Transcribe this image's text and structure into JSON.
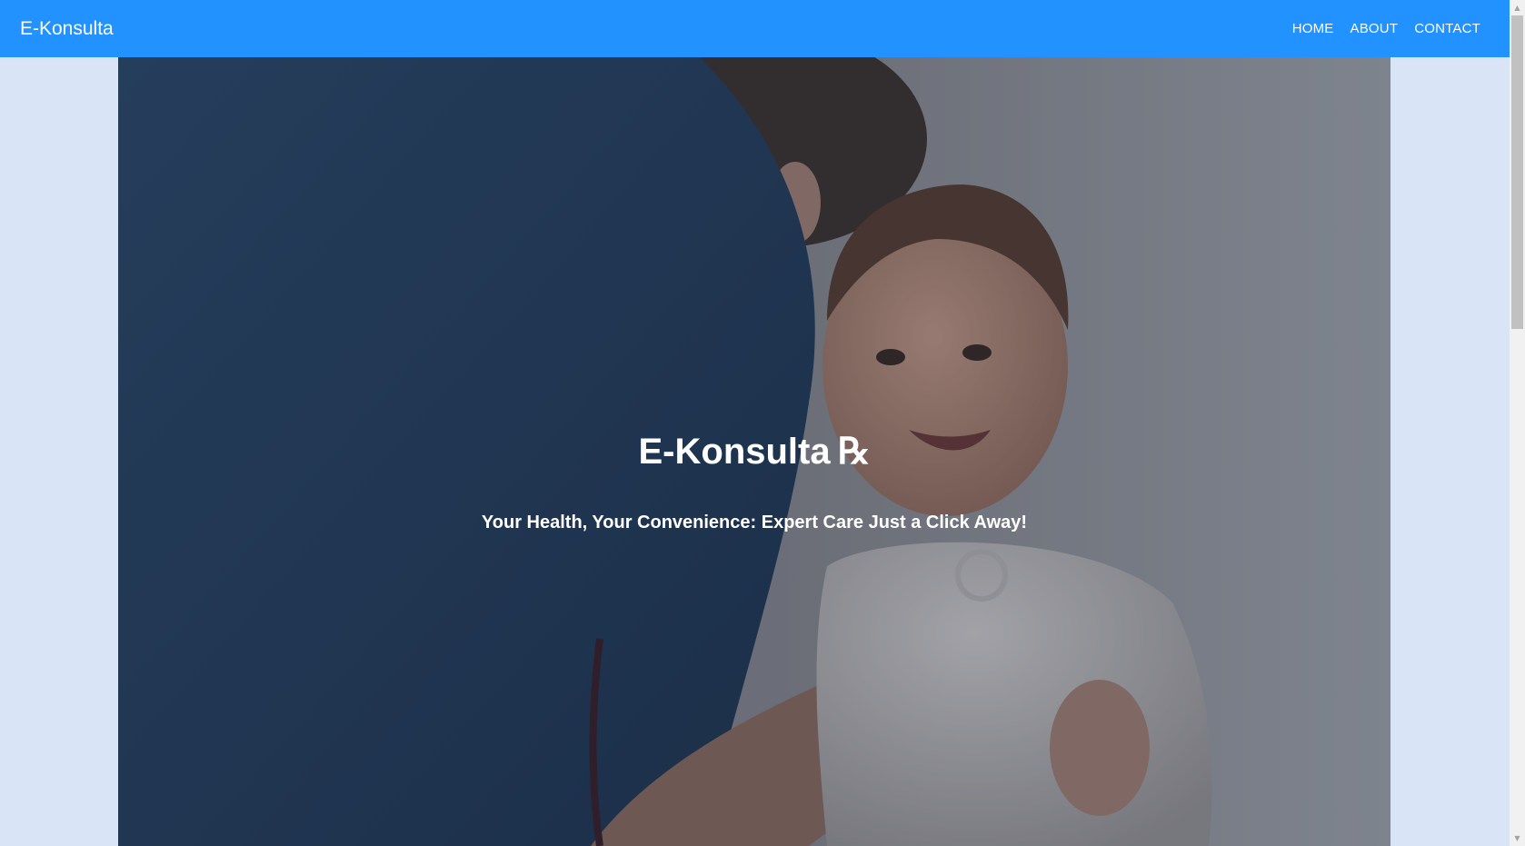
{
  "navbar": {
    "brand": "E-Konsulta",
    "links": [
      "HOME",
      "ABOUT",
      "CONTACT"
    ],
    "background_color": "#2192ff"
  },
  "hero": {
    "title": "E-Konsulta",
    "title_icon": "prescription-rx-icon",
    "title_icon_glyph": "℞",
    "subtitle": "Your Health, Your Convenience: Expert Care Just a Click Away!",
    "image_subject": "doctor examining a smiling baby with a stethoscope"
  },
  "colors": {
    "page_background": "#d9e5f7",
    "nav_text": "#ffffff"
  }
}
